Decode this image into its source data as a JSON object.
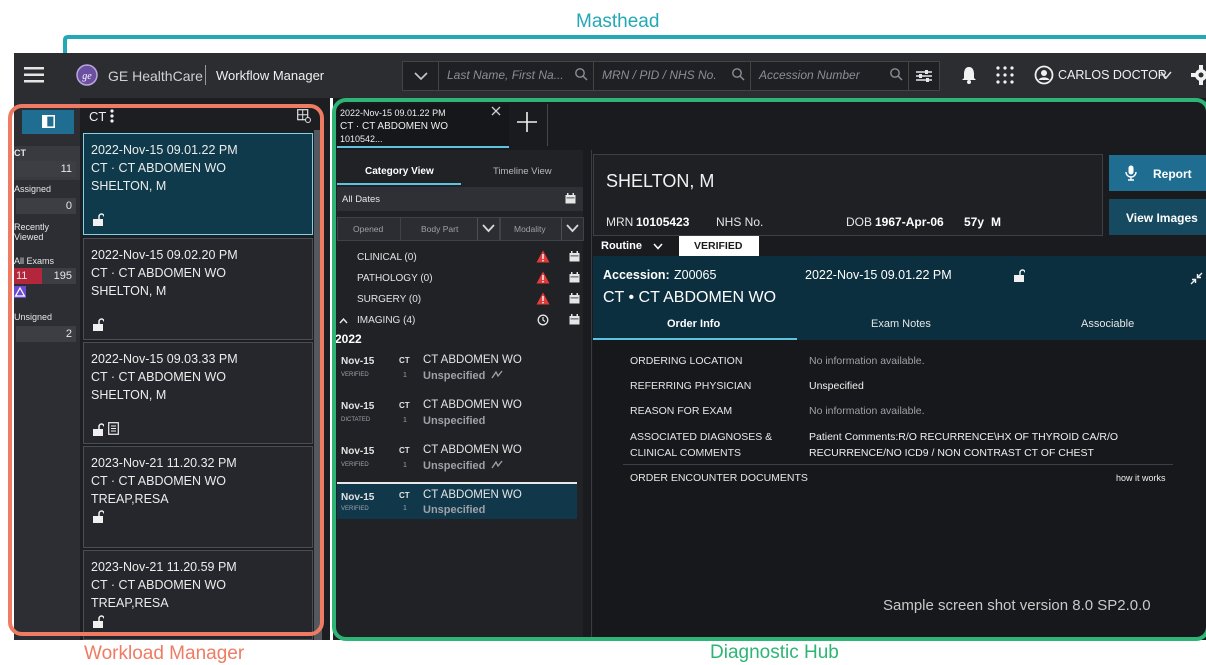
{
  "annotations": {
    "masthead": "Masthead",
    "workload_manager": "Workload Manager",
    "diagnostic_hub": "Diagnostic Hub"
  },
  "colors": {
    "masthead_label": "#23a9b5",
    "workload_frame": "#ef7b62",
    "diagnostic_frame": "#2eb575",
    "accent_button": "#1f6e92",
    "alert": "#e23b3b"
  },
  "masthead": {
    "brand": "GE HealthCare",
    "app": "Workflow Manager",
    "search_name_placeholder": "Last Name, First Na...",
    "search_mrn_placeholder": "MRN / PID / NHS No.",
    "search_accession_placeholder": "Accession Number",
    "user": "CARLOS DOCTOR",
    "icons": [
      "menu-icon",
      "ge-logo-icon",
      "chevron-down-icon",
      "search-icon",
      "filter-icon",
      "bell-icon",
      "grid-icon",
      "user-icon",
      "gear-icon"
    ]
  },
  "workload": {
    "filter_label": "CT",
    "rail": [
      {
        "label": "CT",
        "count": "11"
      },
      {
        "label": "Assigned",
        "count": "0"
      },
      {
        "label": "Recently Viewed",
        "count": ""
      },
      {
        "label": "All Exams",
        "count_red": "11",
        "count": "195"
      },
      {
        "label": "Unsigned",
        "count": "2"
      }
    ],
    "cards": [
      {
        "date": "2022-Nov-15 09.01.22 PM",
        "exam": "CT · CT ABDOMEN WO",
        "patient": "SHELTON, M"
      },
      {
        "date": "2022-Nov-15 09.02.20 PM",
        "exam": "CT · CT ABDOMEN WO",
        "patient": "SHELTON, M"
      },
      {
        "date": "2022-Nov-15 09.03.33 PM",
        "exam": "CT · CT ABDOMEN WO",
        "patient": "SHELTON, M"
      },
      {
        "date": "2023-Nov-21 11.20.32 PM",
        "exam": "CT · CT ABDOMEN WO",
        "patient": "TREAP,RESA"
      },
      {
        "date": "2023-Nov-21 11.20.59 PM",
        "exam": "CT · CT ABDOMEN WO",
        "patient": "TREAP,RESA"
      }
    ]
  },
  "hub": {
    "tab": {
      "line1": "2022-Nov-15 09.01.22 PM",
      "line2": "CT · CT ABDOMEN WO",
      "line3": "1010542..."
    },
    "views": {
      "category": "Category View",
      "timeline": "Timeline View"
    },
    "all_dates": "All Dates",
    "filters": {
      "opened": "Opened",
      "body_part": "Body Part",
      "modality": "Modality"
    },
    "categories": [
      "CLINICAL (0)",
      "PATHOLOGY (0)",
      "SURGERY (0)",
      "IMAGING (4)"
    ],
    "year": "2022",
    "exams": [
      {
        "date": "Nov-15",
        "status": "VERIFIED",
        "mod": "CT",
        "num": "1",
        "name": "CT ABDOMEN WO",
        "sub": "Unspecified"
      },
      {
        "date": "Nov-15",
        "status": "DICTATED",
        "mod": "CT",
        "num": "1",
        "name": "CT ABDOMEN WO",
        "sub": "Unspecified"
      },
      {
        "date": "Nov-15",
        "status": "VERIFIED",
        "mod": "CT",
        "num": "1",
        "name": "CT ABDOMEN WO",
        "sub": "Unspecified"
      },
      {
        "date": "Nov-15",
        "status": "VERIFIED",
        "mod": "CT",
        "num": "1",
        "name": "CT ABDOMEN WO",
        "sub": "Unspecified"
      }
    ],
    "patient": {
      "name": "SHELTON, M",
      "mrn_label": "MRN",
      "mrn": "10105423",
      "nhs_label": "NHS No.",
      "dob_label": "DOB",
      "dob": "1967-Apr-06",
      "age": "57y",
      "sex": "M"
    },
    "buttons": {
      "report": "Report",
      "view_images": "View Images"
    },
    "priority": "Routine",
    "status": "VERIFIED",
    "accession_label": "Accession:",
    "accession": "Z00065",
    "exam_datetime": "2022-Nov-15 09.01.22 PM",
    "exam_title": "CT • CT ABDOMEN WO",
    "detail_tabs": [
      "Order Info",
      "Exam Notes",
      "Associable"
    ],
    "order_info": [
      {
        "label": "ORDERING LOCATION",
        "value": "No information available."
      },
      {
        "label": "REFERRING PHYSICIAN",
        "value": "Unspecified"
      },
      {
        "label": "REASON FOR EXAM",
        "value": "No information available."
      },
      {
        "label": "ASSOCIATED DIAGNOSES &",
        "label2": "CLINICAL COMMENTS",
        "value": "Patient Comments:R/O RECURRENCE\\HX OF THYROID CA/R/O",
        "value2": "RECURRENCE/NO ICD9 / NON CONTRAST CT OF CHEST"
      },
      {
        "label": "ORDER ENCOUNTER DOCUMENTS",
        "value": ""
      }
    ],
    "how_it_works": "how it works",
    "version_note": "Sample screen shot version 8.0 SP2.0.0"
  }
}
